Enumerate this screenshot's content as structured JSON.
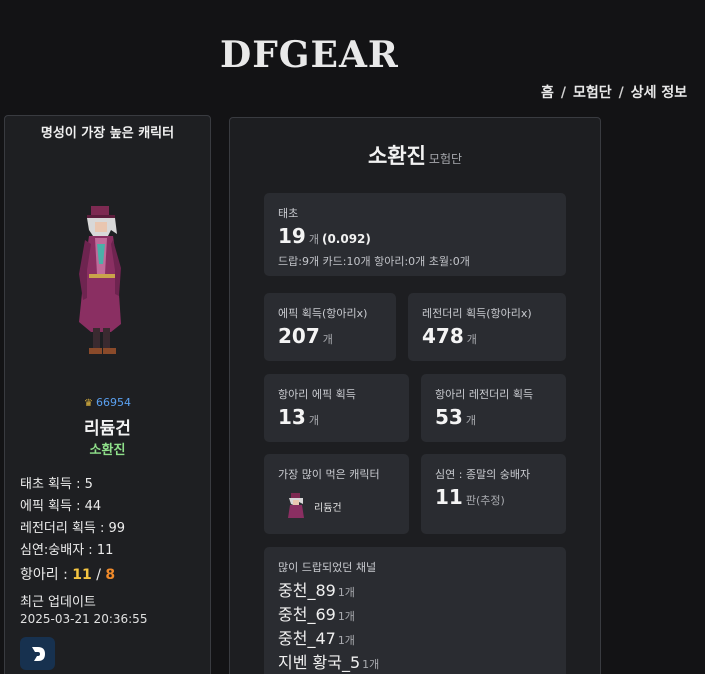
{
  "header": {
    "logo": "DFGEAR",
    "breadcrumb": [
      "홈",
      "모험단",
      "상세 정보"
    ],
    "breadcrumb_sep": "/"
  },
  "left_card": {
    "title": "명성이 가장 높은 캐릭터",
    "fame": "66954",
    "character_name": "리듐건",
    "character_class": "소환진",
    "stats": {
      "taecho": "태초 획득 : 5",
      "epic": "에픽 획득 : 44",
      "legendary": "레전더리 획득 : 99",
      "abyss": "심연:숭배자 : 11",
      "jar_label": "항아리 : ",
      "jar_a": "11",
      "jar_sep": " / ",
      "jar_b": "8"
    },
    "updated_label": "최근 업데이트",
    "updated_time": "2025-03-21 20:36:55",
    "logo_button": "D"
  },
  "main": {
    "title": "소환진",
    "subtitle": "모험단",
    "taecho": {
      "label": "태초",
      "value": "19",
      "unit": "개",
      "ratio": "(0.092)",
      "detail": "드랍:9개 카드:10개 항아리:0개 초월:0개"
    },
    "epic": {
      "label": "에픽 획득(항아리x)",
      "value": "207",
      "unit": "개"
    },
    "legendary": {
      "label": "레전더리 획득(항아리x)",
      "value": "478",
      "unit": "개"
    },
    "jar_epic": {
      "label": "항아리 에픽 획득",
      "value": "13",
      "unit": "개"
    },
    "jar_legendary": {
      "label": "항아리 레전더리 획득",
      "value": "53",
      "unit": "개"
    },
    "most_eaten": {
      "label": "가장 많이 먹은 캐릭터",
      "name": "리듐건"
    },
    "abyss": {
      "label": "심연 : 종말의 숭배자",
      "value": "11",
      "unit": "판(추정)"
    },
    "channels": {
      "label": "많이 드랍되었던 채널",
      "items": [
        {
          "name": "중천_89",
          "count": "1개"
        },
        {
          "name": "중천_69",
          "count": "1개"
        },
        {
          "name": "중천_47",
          "count": "1개"
        },
        {
          "name": "지벤 황국_5",
          "count": "1개"
        }
      ]
    }
  },
  "colors": {
    "background": "#131315",
    "card": "#1e1f22",
    "box": "#2a2c31",
    "fame_blue": "#5aa0f0",
    "class_green": "#8fe08a",
    "jar_yellow": "#f5c542",
    "jar_orange": "#f08a2a"
  },
  "icons": {
    "fame": "crown-icon",
    "logo_button": "dfgear-d-logo-icon"
  }
}
